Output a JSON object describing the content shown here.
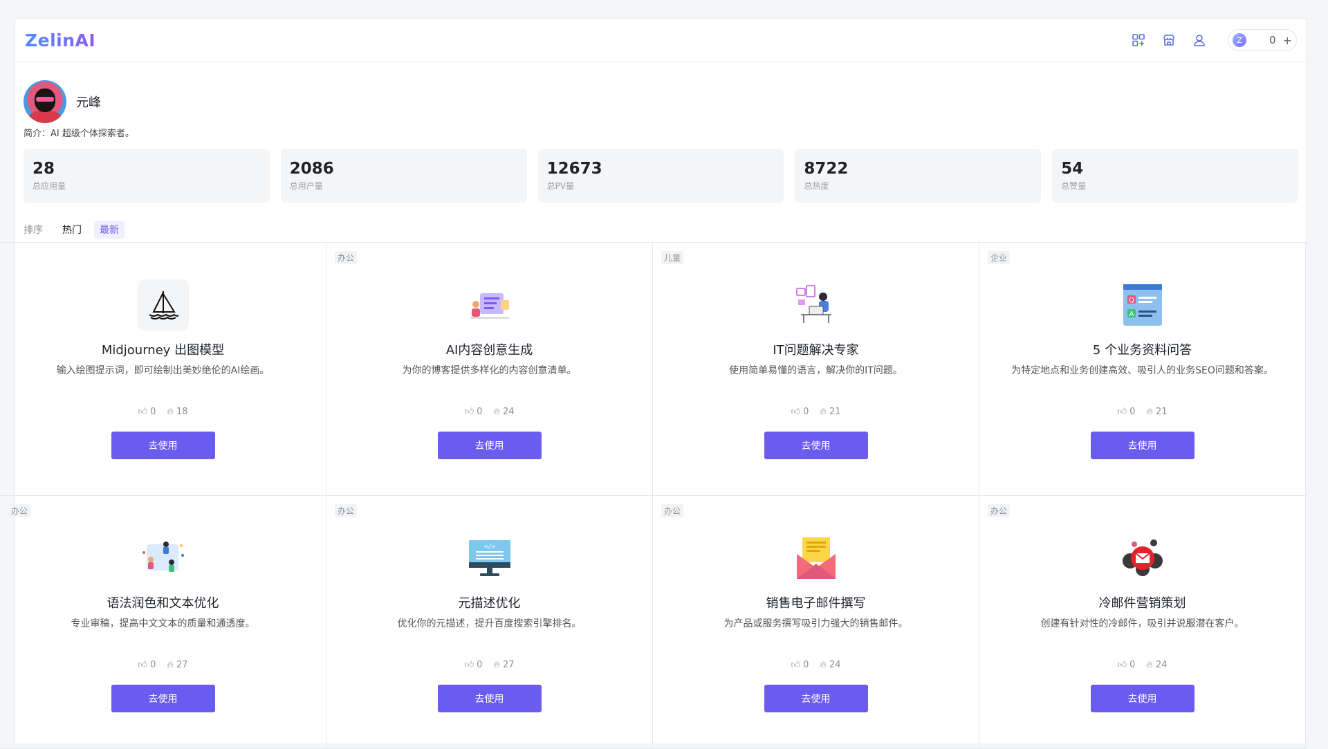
{
  "header": {
    "logo": "ZelinAI",
    "credits": "0",
    "credit_avatar": "Z",
    "credit_plus": "+"
  },
  "profile": {
    "name": "元峰",
    "bio": "简介：AI 超级个体探索者。"
  },
  "stats": [
    {
      "value": "28",
      "label": "总应用量"
    },
    {
      "value": "2086",
      "label": "总用户量"
    },
    {
      "value": "12673",
      "label": "总PV量"
    },
    {
      "value": "8722",
      "label": "总热度"
    },
    {
      "value": "54",
      "label": "总赞量"
    }
  ],
  "sort": {
    "label": "排序",
    "options": [
      "热门",
      "最新"
    ],
    "active": "最新"
  },
  "cards": [
    {
      "tag": "",
      "icon": "sailboat-icon",
      "title": "Midjourney 出图模型",
      "desc": "输入绘图提示词，即可绘制出美妙绝伦的AI绘画。",
      "likes": "0",
      "heat": "18",
      "button": "去使用"
    },
    {
      "tag": "办公",
      "icon": "content-creation-icon",
      "title": "AI内容创意生成",
      "desc": "为你的博客提供多样化的内容创意清单。",
      "likes": "0",
      "heat": "24",
      "button": "去使用"
    },
    {
      "tag": "儿童",
      "icon": "it-expert-icon",
      "title": "IT问题解决专家",
      "desc": "使用简单易懂的语言，解决你的IT问题。",
      "likes": "0",
      "heat": "21",
      "button": "去使用"
    },
    {
      "tag": "企业",
      "icon": "qa-document-icon",
      "title": "5 个业务资料问答",
      "desc": "为特定地点和业务创建高效、吸引人的业务SEO问题和答案。",
      "likes": "0",
      "heat": "21",
      "button": "去使用"
    },
    {
      "tag": "办公",
      "icon": "text-polish-icon",
      "title": "语法润色和文本优化",
      "desc": "专业审稿，提高中文文本的质量和通透度。",
      "likes": "0",
      "heat": "27",
      "button": "去使用"
    },
    {
      "tag": "办公",
      "icon": "monitor-code-icon",
      "title": "元描述优化",
      "desc": "优化你的元描述，提升百度搜索引擎排名。",
      "likes": "0",
      "heat": "27",
      "button": "去使用"
    },
    {
      "tag": "办公",
      "icon": "envelope-letter-icon",
      "title": "销售电子邮件撰写",
      "desc": "为产品或服务撰写吸引力强大的销售邮件。",
      "likes": "0",
      "heat": "24",
      "button": "去使用"
    },
    {
      "tag": "办公",
      "icon": "cold-mail-icon",
      "title": "冷邮件营销策划",
      "desc": "创建有针对性的冷邮件，吸引并说服潜在客户。",
      "likes": "0",
      "heat": "24",
      "button": "去使用"
    }
  ],
  "colors": {
    "accent": "#6b5cf0",
    "border": "#e6e8eb",
    "stat_bg": "#f4f5f7"
  }
}
